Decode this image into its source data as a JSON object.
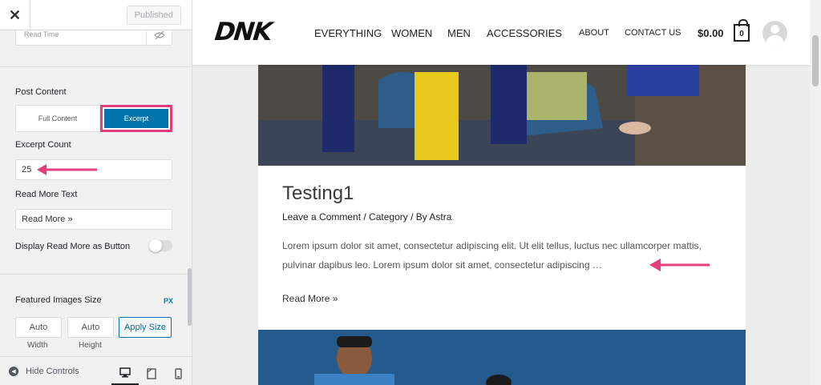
{
  "customizer": {
    "published_label": "Published",
    "read_time_label": "Read Time",
    "post_content": {
      "label": "Post Content",
      "options": [
        "Full Content",
        "Excerpt"
      ],
      "selected": "Excerpt"
    },
    "excerpt_count": {
      "label": "Excerpt Count",
      "value": "25"
    },
    "read_more_text": {
      "label": "Read More Text",
      "value": "Read More »"
    },
    "display_read_more_button": {
      "label": "Display Read More as Button",
      "enabled": false
    },
    "featured_images_size": {
      "label": "Featured Images Size",
      "unit": "PX",
      "width_value": "Auto",
      "height_value": "Auto",
      "width_caption": "Width",
      "height_caption": "Height",
      "apply_label": "Apply Size"
    },
    "footer": {
      "hide_controls_label": "Hide Controls",
      "active_device": "desktop"
    }
  },
  "site": {
    "logo": "DNK",
    "nav": [
      "EVERYTHING",
      "WOMEN",
      "MEN",
      "ACCESSORIES"
    ],
    "nav_secondary": [
      "ABOUT",
      "CONTACT US"
    ],
    "cart_total": "$0.00",
    "cart_count": "0"
  },
  "post": {
    "title": "Testing1",
    "meta": "Leave a Comment / Category / By Astra",
    "excerpt": "Lorem ipsum dolor sit amet, consectetur adipiscing elit. Ut elit tellus, luctus nec ullamcorper mattis, pulvinar dapibus leo. Lorem ipsum dolor sit amet, consectetur adipiscing …",
    "read_more": "Read More »"
  },
  "colors": {
    "accent": "#0073aa",
    "highlight": "#e53e7d"
  }
}
